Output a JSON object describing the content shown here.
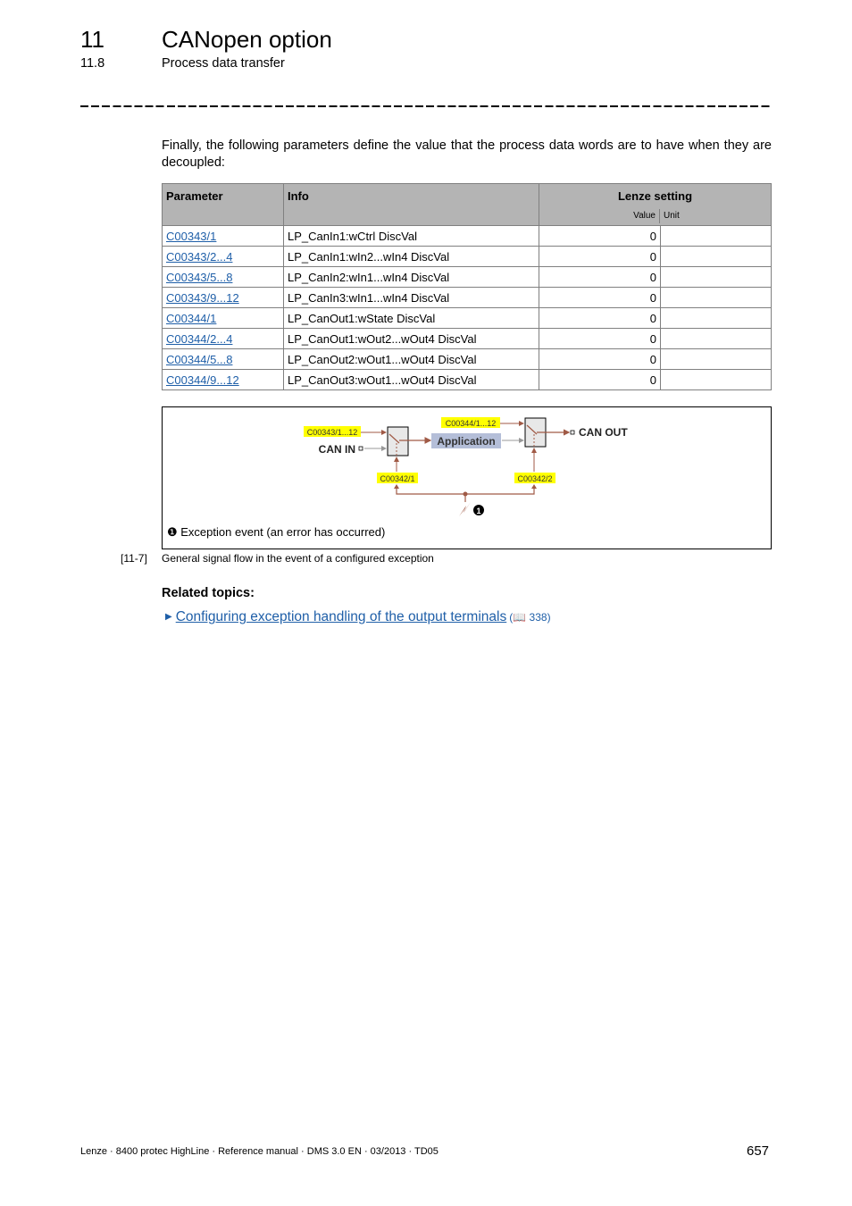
{
  "header": {
    "chapter_number": "11",
    "chapter_title": "CANopen option",
    "section_number": "11.8",
    "section_title": "Process data transfer"
  },
  "intro_text": "Finally, the following parameters define the value that the process data words are to have when they are decoupled:",
  "table": {
    "headers": {
      "parameter": "Parameter",
      "info": "Info",
      "lenze_setting": "Lenze setting",
      "value": "Value",
      "unit": "Unit"
    },
    "rows": [
      {
        "parameter": "C00343/1",
        "info": "LP_CanIn1:wCtrl DiscVal",
        "value": "0",
        "unit": ""
      },
      {
        "parameter": "C00343/2...4",
        "info": "LP_CanIn1:wIn2...wIn4 DiscVal",
        "value": "0",
        "unit": ""
      },
      {
        "parameter": "C00343/5...8",
        "info": "LP_CanIn2:wIn1...wIn4 DiscVal",
        "value": "0",
        "unit": ""
      },
      {
        "parameter": "C00343/9...12",
        "info": "LP_CanIn3:wIn1...wIn4 DiscVal",
        "value": "0",
        "unit": ""
      },
      {
        "parameter": "C00344/1",
        "info": "LP_CanOut1:wState DiscVal",
        "value": "0",
        "unit": ""
      },
      {
        "parameter": "C00344/2...4",
        "info": "LP_CanOut1:wOut2...wOut4 DiscVal",
        "value": "0",
        "unit": ""
      },
      {
        "parameter": "C00344/5...8",
        "info": "LP_CanOut2:wOut1...wOut4 DiscVal",
        "value": "0",
        "unit": ""
      },
      {
        "parameter": "C00344/9...12",
        "info": "LP_CanOut3:wOut1...wOut4 DiscVal",
        "value": "0",
        "unit": ""
      }
    ]
  },
  "diagram": {
    "labels": {
      "c343": "C00343/1...12",
      "c344": "C00344/1...12",
      "c342_1": "C00342/1",
      "c342_2": "C00342/2",
      "can_in": "CAN IN",
      "can_out": "CAN OUT",
      "application": "Application",
      "marker": "❶"
    },
    "legend": "❶ Exception event (an error has occurred)",
    "colors": {
      "highlight": "#ffff00",
      "signal": "#a05a46",
      "application_bg": "#b4bed8",
      "grey_signal": "#999999"
    }
  },
  "caption": {
    "number": "[11-7]",
    "text": "General signal flow in the event of a configured exception"
  },
  "related": {
    "title": "Related topics:",
    "items": [
      {
        "label": "Configuring exception handling of the output terminals",
        "page_ref": "338",
        "book_icon": "📖"
      }
    ]
  },
  "footer": {
    "left": "Lenze · 8400 protec HighLine · Reference manual · DMS 3.0 EN · 03/2013 · TD05",
    "page": "657"
  }
}
